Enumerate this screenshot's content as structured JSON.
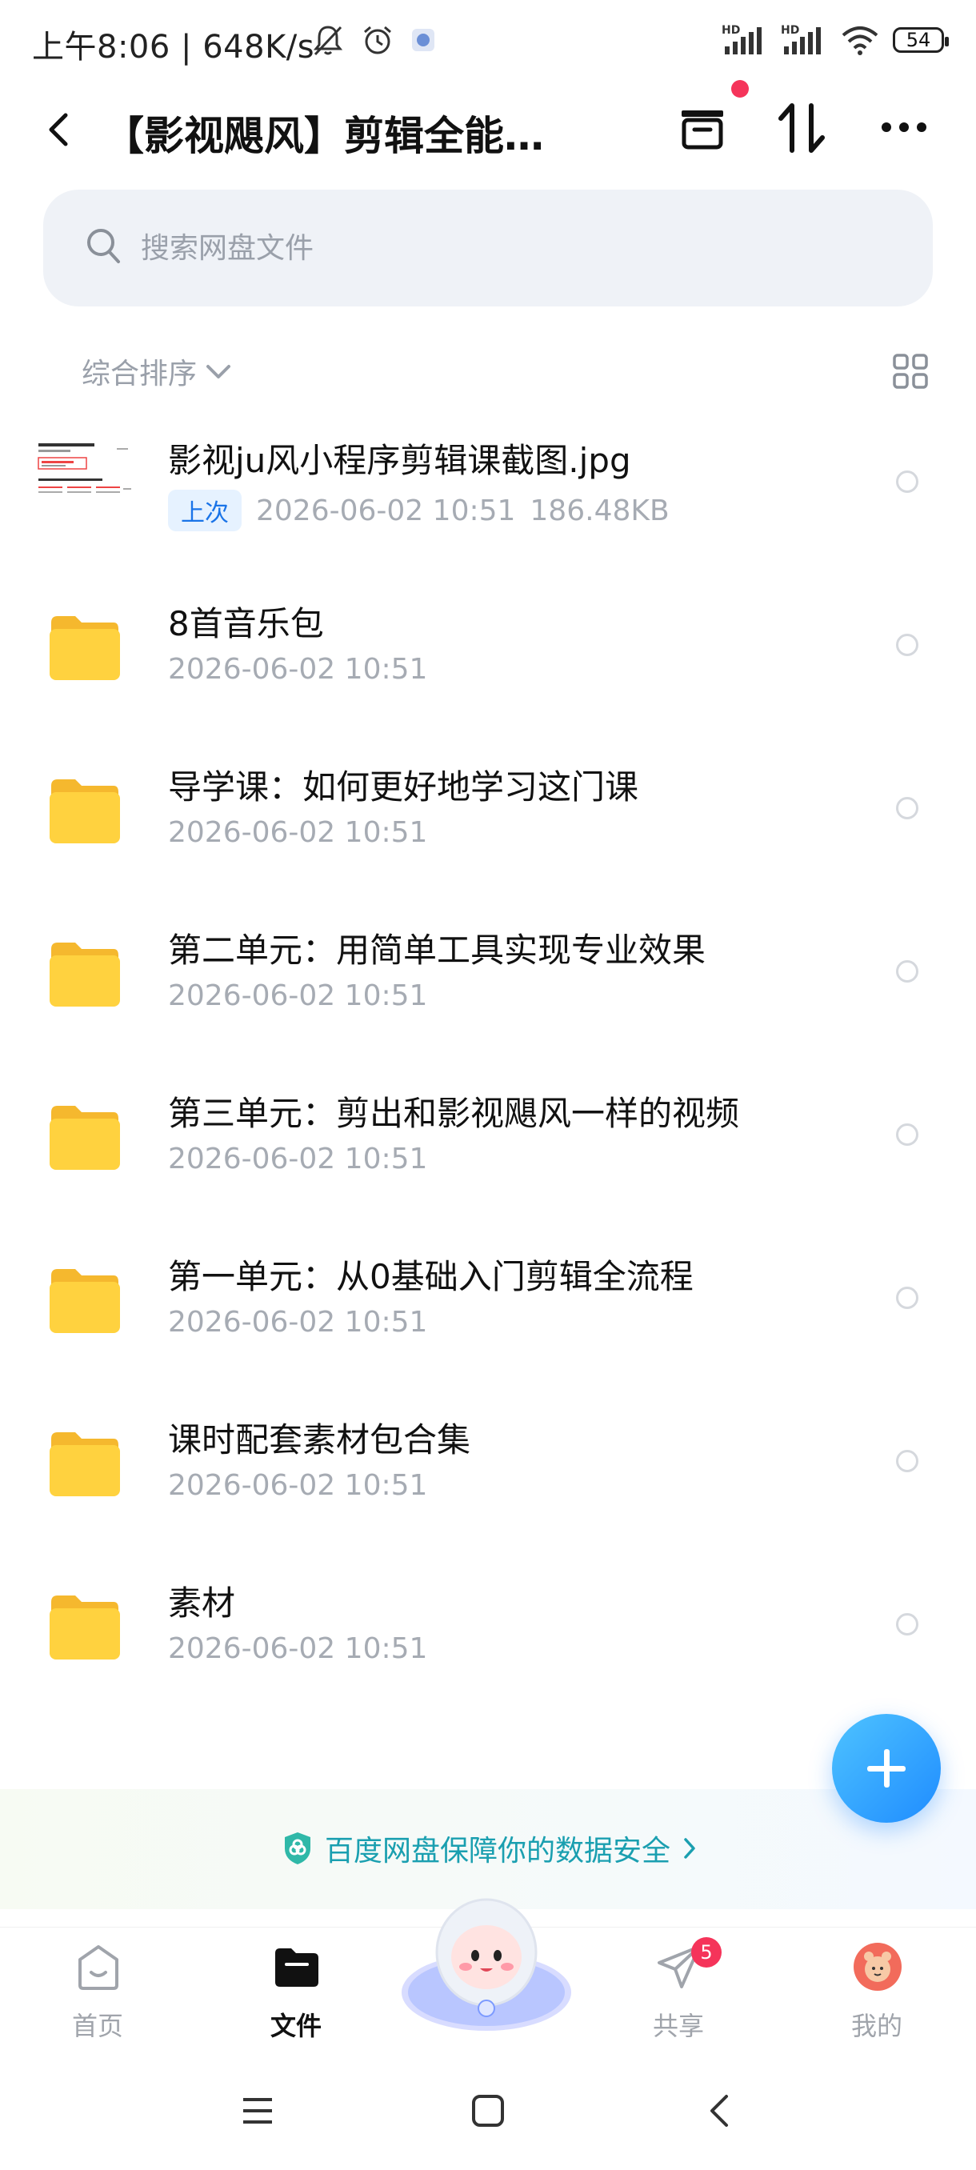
{
  "status_bar": {
    "time": "上午8:06 | 648K/s",
    "battery": "54",
    "signal_labels": [
      "HD",
      "HD"
    ]
  },
  "header": {
    "title": "【影视飓风】剪辑全能必..."
  },
  "search": {
    "placeholder": "搜索网盘文件"
  },
  "sort": {
    "label": "综合排序"
  },
  "files": [
    {
      "name": "影视ju风小程序剪辑课截图.jpg",
      "badge": "上次",
      "date": "2026-06-02  10:51",
      "size": "186.48KB",
      "type": "image"
    },
    {
      "name": "8首音乐包",
      "date": "2026-06-02  10:51",
      "type": "folder"
    },
    {
      "name": "导学课：如何更好地学习这门课",
      "date": "2026-06-02  10:51",
      "type": "folder"
    },
    {
      "name": "第二单元：用简单工具实现专业效果",
      "date": "2026-06-02  10:51",
      "type": "folder"
    },
    {
      "name": "第三单元：剪出和影视飓风一样的视频",
      "date": "2026-06-02  10:51",
      "type": "folder"
    },
    {
      "name": "第一单元：从0基础入门剪辑全流程",
      "date": "2026-06-02  10:51",
      "type": "folder"
    },
    {
      "name": "课时配套素材包合集",
      "date": "2026-06-02  10:51",
      "type": "folder"
    },
    {
      "name": "素材",
      "date": "2026-06-02  10:51",
      "type": "folder"
    }
  ],
  "banner": {
    "text": "百度网盘保障你的数据安全"
  },
  "tabs": [
    {
      "label": "首页",
      "icon": "home-icon"
    },
    {
      "label": "文件",
      "icon": "folder-icon",
      "active": true
    },
    {
      "label": "共享",
      "icon": "share-icon",
      "badge": "5"
    },
    {
      "label": "我的",
      "icon": "avatar-icon"
    }
  ],
  "colors": {
    "accent": "#1f8cff",
    "folder": "#ffcc33",
    "badge_red": "#f5345a",
    "banner_text": "#1a9fb0"
  }
}
